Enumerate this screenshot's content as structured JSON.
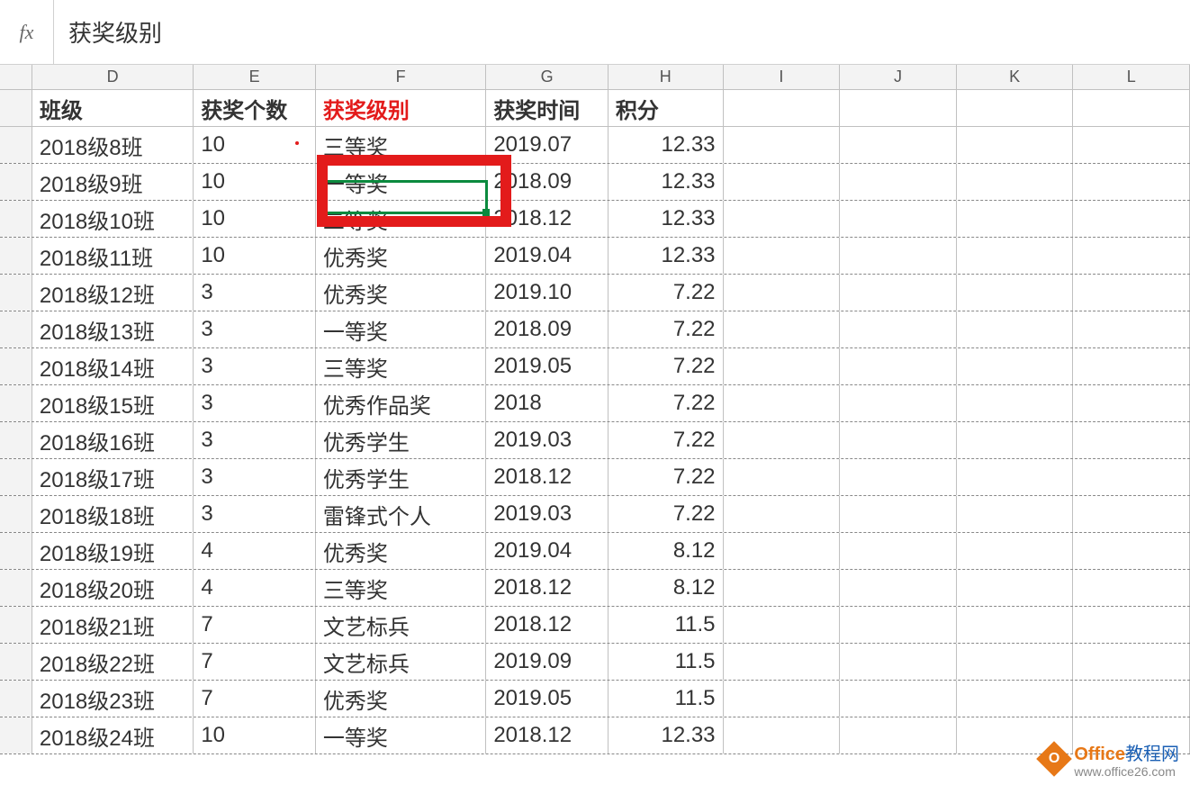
{
  "formula_bar": {
    "fx": "fx",
    "value": "获奖级别"
  },
  "columns": [
    "D",
    "E",
    "F",
    "G",
    "H",
    "I",
    "J",
    "K",
    "L"
  ],
  "headers": {
    "D": "班级",
    "E": "获奖个数",
    "F": "获奖级别",
    "G": "获奖时间",
    "H": "积分"
  },
  "rows": [
    {
      "D": "2018级8班",
      "E": "10",
      "F": "三等奖",
      "G": "2019.07",
      "H": "12.33"
    },
    {
      "D": "2018级9班",
      "E": "10",
      "F": "一等奖",
      "G": "2018.09",
      "H": "12.33"
    },
    {
      "D": "2018级10班",
      "E": "10",
      "F": "二等奖",
      "G": "2018.12",
      "H": "12.33"
    },
    {
      "D": "2018级11班",
      "E": "10",
      "F": "优秀奖",
      "G": "2019.04",
      "H": "12.33"
    },
    {
      "D": "2018级12班",
      "E": "3",
      "F": "优秀奖",
      "G": "2019.10",
      "H": "7.22"
    },
    {
      "D": "2018级13班",
      "E": "3",
      "F": "一等奖",
      "G": "2018.09",
      "H": "7.22"
    },
    {
      "D": "2018级14班",
      "E": "3",
      "F": "三等奖",
      "G": "2019.05",
      "H": "7.22"
    },
    {
      "D": "2018级15班",
      "E": "3",
      "F": "优秀作品奖",
      "G": "2018",
      "H": "7.22"
    },
    {
      "D": "2018级16班",
      "E": "3",
      "F": "优秀学生",
      "G": "2019.03",
      "H": "7.22"
    },
    {
      "D": "2018级17班",
      "E": "3",
      "F": "优秀学生",
      "G": "2018.12",
      "H": "7.22"
    },
    {
      "D": "2018级18班",
      "E": "3",
      "F": "雷锋式个人",
      "G": "2019.03",
      "H": "7.22"
    },
    {
      "D": "2018级19班",
      "E": "4",
      "F": "优秀奖",
      "G": "2019.04",
      "H": "8.12"
    },
    {
      "D": "2018级20班",
      "E": "4",
      "F": "三等奖",
      "G": "2018.12",
      "H": "8.12"
    },
    {
      "D": "2018级21班",
      "E": "7",
      "F": "文艺标兵",
      "G": "2018.12",
      "H": "11.5"
    },
    {
      "D": "2018级22班",
      "E": "7",
      "F": "文艺标兵",
      "G": "2019.09",
      "H": "11.5"
    },
    {
      "D": "2018级23班",
      "E": "7",
      "F": "优秀奖",
      "G": "2019.05",
      "H": "11.5"
    },
    {
      "D": "2018级24班",
      "E": "10",
      "F": "一等奖",
      "G": "2018.12",
      "H": "12.33"
    }
  ],
  "watermark": {
    "brand": "Office",
    "suffix": "教程网",
    "url": "www.office26.com"
  }
}
